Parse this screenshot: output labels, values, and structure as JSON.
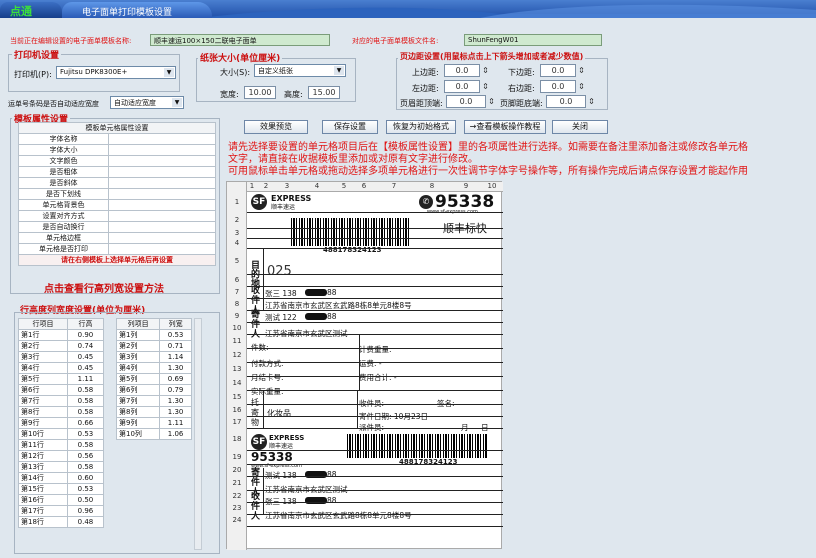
{
  "tabs": {
    "app": "点通",
    "window": "电子面单打印模板设置"
  },
  "header": {
    "current_label": "当前正在编辑设置的电子面单模板名称:",
    "current_value": "顺丰速运100×150二联电子面单",
    "file_label": "对应的电子面单模板文件名:",
    "file_value": "ShunFengW01"
  },
  "printer": {
    "section": "打印机设置",
    "label": "打印机(P):",
    "value": "Fujitsu DPK8300E+"
  },
  "paper": {
    "section": "纸张大小(单位厘米)",
    "size_label": "大小(S):",
    "size_value": "自定义纸张",
    "width_label": "宽度:",
    "width_value": "10.00",
    "height_label": "高度:",
    "height_value": "15.00"
  },
  "margins": {
    "section": "页边距设置(用鼠标点击上下箭头增加或者减少数值)",
    "top_label": "上边距:",
    "top_value": "0.0",
    "bottom_label": "下边距:",
    "bottom_value": "0.0",
    "left_label": "左边距:",
    "left_value": "0.0",
    "right_label": "右边距:",
    "right_value": "0.0",
    "header_label": "页眉距顶端:",
    "header_value": "0.0",
    "footer_label": "页脚距底端:",
    "footer_value": "0.0"
  },
  "spare": {
    "label": "运单号条码是否自动适应宽度",
    "value": "自动适应宽度"
  },
  "template_props": {
    "section": "模板属性设置",
    "header": "模板单元格属性设置",
    "items": [
      "字体名称",
      "字体大小",
      "文字颜色",
      "是否粗体",
      "是否斜体",
      "是否下划线",
      "单元格背景色",
      "设置对齐方式",
      "是否自动换行",
      "单元格边框",
      "单元格是否打印"
    ],
    "hint": "请在右侧模板上选择单元格后再设置",
    "link": "点击查看行高列宽设置方法"
  },
  "rowcol": {
    "section": "行高度列宽度设置(单位为厘米)",
    "row_headers": [
      "行项目",
      "行高"
    ],
    "rows": [
      [
        "第1行",
        "0.90"
      ],
      [
        "第2行",
        "0.74"
      ],
      [
        "第3行",
        "0.45"
      ],
      [
        "第4行",
        "0.45"
      ],
      [
        "第5行",
        "1.11"
      ],
      [
        "第6行",
        "0.58"
      ],
      [
        "第7行",
        "0.58"
      ],
      [
        "第8行",
        "0.58"
      ],
      [
        "第9行",
        "0.66"
      ],
      [
        "第10行",
        "0.53"
      ],
      [
        "第11行",
        "0.58"
      ],
      [
        "第12行",
        "0.56"
      ],
      [
        "第13行",
        "0.58"
      ],
      [
        "第14行",
        "0.60"
      ],
      [
        "第15行",
        "0.53"
      ],
      [
        "第16行",
        "0.50"
      ],
      [
        "第17行",
        "0.96"
      ],
      [
        "第18行",
        "0.48"
      ]
    ],
    "col_headers": [
      "列项目",
      "列宽"
    ],
    "cols": [
      [
        "第1列",
        "0.53"
      ],
      [
        "第2列",
        "0.71"
      ],
      [
        "第3列",
        "1.14"
      ],
      [
        "第4列",
        "1.30"
      ],
      [
        "第5列",
        "0.69"
      ],
      [
        "第6列",
        "0.79"
      ],
      [
        "第7列",
        "1.30"
      ],
      [
        "第8列",
        "1.30"
      ],
      [
        "第9列",
        "1.11"
      ],
      [
        "第10列",
        "1.06"
      ]
    ]
  },
  "buttons": {
    "preview": "效果预览",
    "save": "保存设置",
    "restore": "恢复为初始格式",
    "tutorial": "→查看模板操作教程",
    "close": "关闭"
  },
  "instructions": [
    "请先选择要设置的单元格项目后在【模板属性设置】里的各项属性进行选择。如需要在备注里添加备注或修改各单元格",
    "文字，请直接在收据模板里添加或对原有文字进行修改。",
    "可用鼠标单击单元格或拖动选择多项单元格进行一次性调节字体字号操作等，所有操作完成后请点保存设置才能起作用"
  ],
  "waybill": {
    "col_numbers": [
      "1",
      "2",
      "3",
      "4",
      "5",
      "6",
      "7",
      "8",
      "9",
      "10"
    ],
    "row_numbers": [
      "1",
      "2",
      "3",
      "4",
      "5",
      "6",
      "7",
      "8",
      "9",
      "10",
      "11",
      "12",
      "13",
      "14",
      "15",
      "16",
      "17",
      "18",
      "19",
      "20",
      "21",
      "22",
      "23",
      "24"
    ],
    "logo_express": "EXPRESS",
    "logo_cn": "顺丰速运",
    "hotline": "95338",
    "website": "www.sf-express.com",
    "tracking": "488178324123",
    "badge": "顺丰标快",
    "dest_label": "目的地",
    "dest_code": "025",
    "recv_label": "收件人",
    "recv_name": "张三 138",
    "recv_phone_tail": "88",
    "recv_addr": "江苏省南京市玄武区玄武路8栋8单元8楼8号",
    "send_label": "寄件人",
    "send_name": "测试 122",
    "send_phone_tail": "88",
    "send_addr": "江苏省南京市玄武区测试",
    "pieces": "件数:",
    "weight": "计费重量:",
    "pay": "付款方式:",
    "freight": "运费: -",
    "account": "月结卡号:",
    "total": "费用合计: -",
    "actual": "实际重量:",
    "consign_label": "托寄物",
    "goods": "化妆品",
    "receiver_sig": "收件员:",
    "sign": "签名:",
    "send_date": "寄件日期: 10月23日",
    "courier": "派件员:",
    "month": "月",
    "day": "日",
    "lower_recv_name": "测试 138",
    "lower_recv_tail": "88",
    "lower_addr1": "江苏省南京市玄武区测试",
    "lower_send_name": "张三 138",
    "lower_send_tail": "88",
    "lower_addr2": "江苏省南京市玄武区玄武路8栋8单元8楼8号"
  }
}
